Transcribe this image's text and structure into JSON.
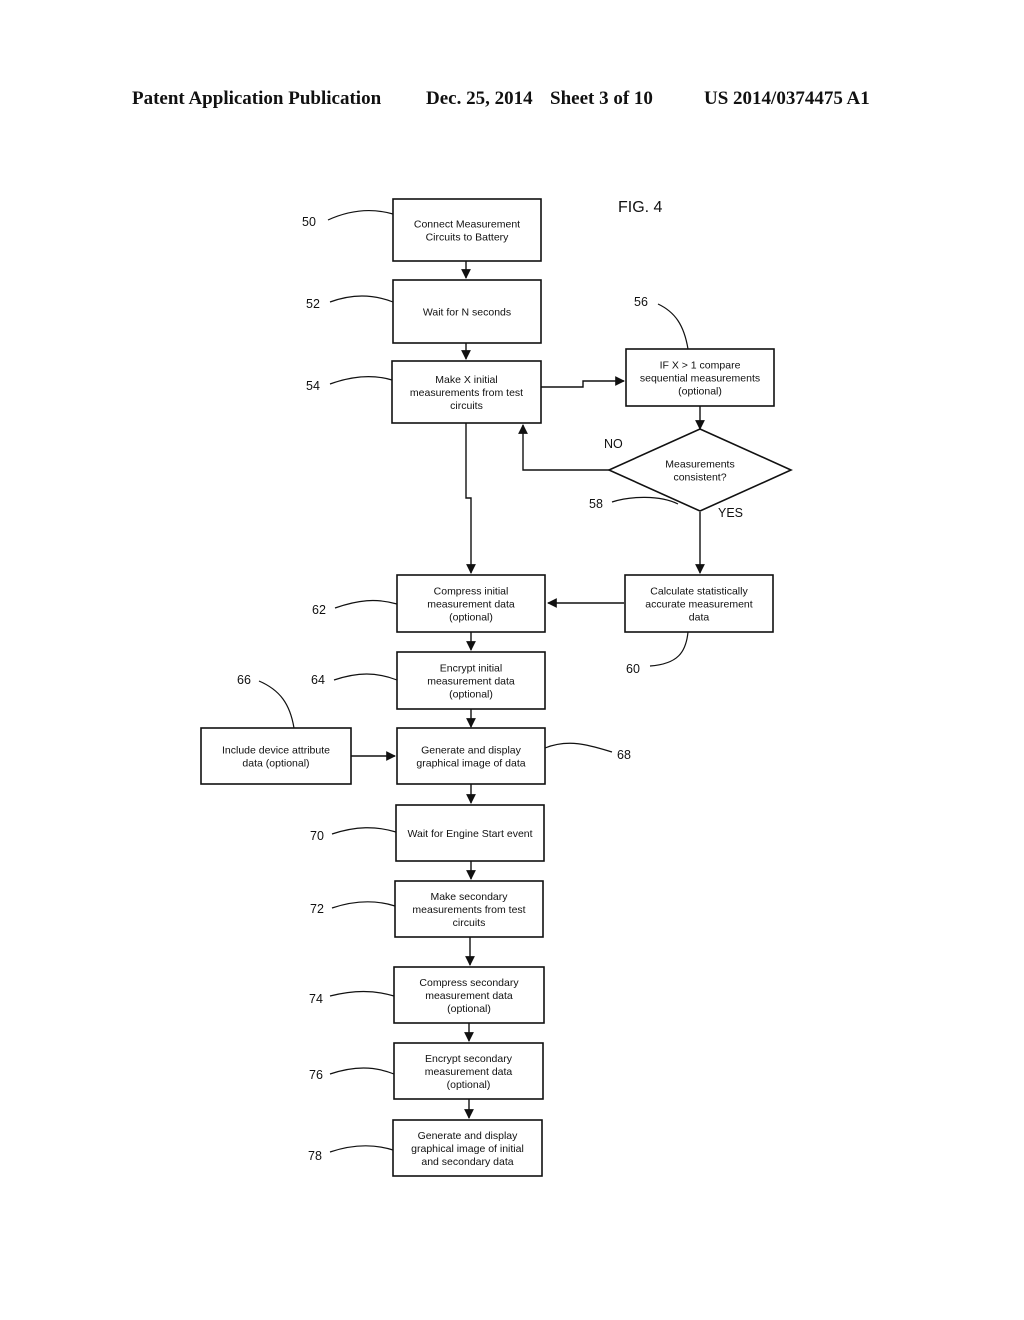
{
  "header": {
    "publication": "Patent Application Publication",
    "date": "Dec. 25, 2014",
    "sheet": "Sheet 3 of 10",
    "number": "US 2014/0374475 A1"
  },
  "figure": {
    "label": "FIG. 4",
    "steps": [
      {
        "ref": "50",
        "lines": [
          "Connect Measurement",
          "Circuits to Battery"
        ]
      },
      {
        "ref": "52",
        "lines": [
          "Wait for N seconds"
        ]
      },
      {
        "ref": "54",
        "lines": [
          "Make X initial",
          "measurements from test",
          "circuits"
        ]
      },
      {
        "ref": "56",
        "lines": [
          "IF X > 1 compare",
          "sequential measurements",
          "(optional)"
        ]
      },
      {
        "ref": "58",
        "lines": [
          "Measurements",
          "consistent?"
        ],
        "shape": "decision",
        "no_label": "NO",
        "yes_label": "YES"
      },
      {
        "ref": "60",
        "lines": [
          "Calculate statistically",
          "accurate measurement",
          "data"
        ]
      },
      {
        "ref": "62",
        "lines": [
          "Compress initial",
          "measurement data",
          "(optional)"
        ]
      },
      {
        "ref": "64",
        "lines": [
          "Encrypt initial",
          "measurement data",
          "(optional)"
        ]
      },
      {
        "ref": "66",
        "lines": [
          "Include device attribute",
          "data (optional)"
        ]
      },
      {
        "ref": "68",
        "lines": [
          "Generate and display",
          "graphical image of data"
        ]
      },
      {
        "ref": "70",
        "lines": [
          "Wait for Engine Start event"
        ]
      },
      {
        "ref": "72",
        "lines": [
          "Make secondary",
          "measurements from test",
          "circuits"
        ]
      },
      {
        "ref": "74",
        "lines": [
          "Compress secondary",
          "measurement data",
          "(optional)"
        ]
      },
      {
        "ref": "76",
        "lines": [
          "Encrypt secondary",
          "measurement data",
          "(optional)"
        ]
      },
      {
        "ref": "78",
        "lines": [
          "Generate and display",
          "graphical image of initial",
          "and secondary data"
        ]
      }
    ]
  }
}
